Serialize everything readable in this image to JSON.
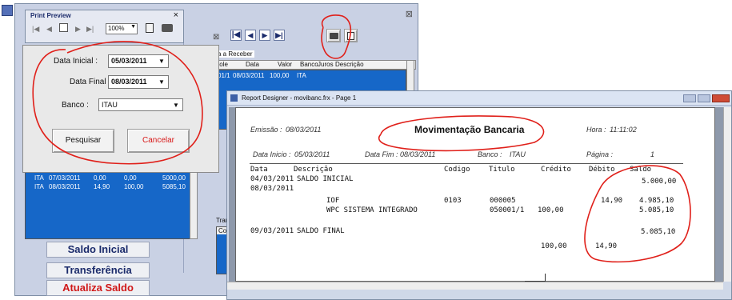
{
  "app_icon": "app-icon",
  "preview": {
    "title": "Print Preview",
    "zoom": "100%",
    "icons": [
      "first-page-icon",
      "prev-page-icon",
      "copy-icon",
      "next-page-icon",
      "last-page-icon",
      "export-icon",
      "print-icon"
    ],
    "close": "×"
  },
  "filter": {
    "data_inicial_label": "Data Inicial :",
    "data_inicial_value": "05/03/2011",
    "data_final_label": "Data Final :",
    "data_final_value": "08/03/2011",
    "banco_label": "Banco :",
    "banco_value": "ITAU",
    "pesquisar": "Pesquisar",
    "cancelar": "Cancelar"
  },
  "left_grid": {
    "rows": [
      [
        "ITA",
        "07/03/2011",
        "0,00",
        "0,00",
        "5000,00"
      ],
      [
        "ITA",
        "08/03/2011",
        "14,90",
        "100,00",
        "5085,10"
      ]
    ]
  },
  "side_buttons": {
    "saldo_inicial": "Saldo Inicial",
    "transferencia": "Transferência",
    "atualiza_saldo": "Atualiza Saldo"
  },
  "main": {
    "close": "⊠",
    "small_close": "⊠",
    "tab_label": "a a Receber",
    "columns": [
      "tole",
      "Data",
      "Valor",
      "Banco",
      "Juros",
      "Descrição"
    ],
    "row": [
      "01/1",
      "08/03/2011",
      "100,00",
      "ITA"
    ],
    "transfer_label": "Transfe",
    "conf_label": "Conf"
  },
  "report_window": {
    "title": "Report Designer - movibanc.frx - Page 1",
    "controls": [
      "minimize",
      "maximize",
      "close"
    ]
  },
  "report": {
    "emissao_label": "Emissão :",
    "emissao_value": "08/03/2011",
    "title": "Movimentação Bancaria",
    "hora_label": "Hora :",
    "hora_value": "11:11:02",
    "data_inicio_label": "Data Inicio :",
    "data_inicio_value": "05/03/2011",
    "data_fim_label": "Data Fim :",
    "data_fim_value": "08/03/2011",
    "banco_label": "Banco :",
    "banco_value": "ITAU",
    "pagina_label": "Página :",
    "pagina_value": "1",
    "columns": {
      "data": "Data",
      "descricao": "Descrição",
      "codigo": "Codigo",
      "titulo": "Titulo",
      "credito": "Crédito",
      "debito": "Débito",
      "saldo": "Saldo"
    },
    "lines": {
      "l1_data": "04/03/2011",
      "l1_desc": "SALDO INICIAL",
      "l1_saldo": "5.000,00",
      "l2_data": "08/03/2011",
      "l3_desc": "IOF",
      "l3_codigo": "0103",
      "l3_titulo": "000005",
      "l3_debito": "14,90",
      "l3_saldo": "4.985,10",
      "l4_desc": "WPC SISTEMA INTEGRADO",
      "l4_titulo": "050001/1",
      "l4_credito": "100,00",
      "l4_saldo": "5.085,10",
      "l5_data": "09/03/2011",
      "l5_desc": "SALDO FINAL",
      "l5_saldo": "5.085,10",
      "tot_credito": "100,00",
      "tot_debito": "14,90"
    }
  }
}
